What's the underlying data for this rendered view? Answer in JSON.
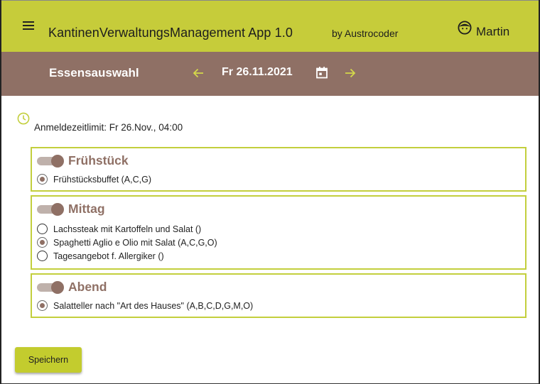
{
  "app": {
    "title": "KantinenVerwaltungsManagement App 1.0",
    "subtitle": "by Austrocoder",
    "user": "Martin"
  },
  "subbar": {
    "title": "Essensauswahl",
    "date": "Fr 26.11.2021"
  },
  "deadline": "Anmeldezeitlimit: Fr 26.Nov., 04:00",
  "sections": [
    {
      "title": "Frühstück",
      "enabled": true,
      "options": [
        {
          "label": "Frühstücksbuffet (A,C,G)",
          "selected": true
        }
      ]
    },
    {
      "title": "Mittag",
      "enabled": true,
      "options": [
        {
          "label": "Lachssteak mit Kartoffeln und Salat ()",
          "selected": false
        },
        {
          "label": "Spaghetti Aglio e Olio mit Salat (A,C,G,O)",
          "selected": true
        },
        {
          "label": "Tagesangebot f. Allergiker ()",
          "selected": false
        }
      ]
    },
    {
      "title": "Abend",
      "enabled": true,
      "options": [
        {
          "label": "Salatteller nach \"Art des Hauses\" (A,B,C,D,G,M,O)",
          "selected": true
        }
      ]
    }
  ],
  "save_label": "Speichern",
  "colors": {
    "appbar": "#c6cc3a",
    "subbar": "#8f7065",
    "accent": "#c3cf3d",
    "brown": "#8f7065"
  },
  "icons": [
    "menu-icon",
    "user-face-icon",
    "arrow-left-icon",
    "calendar-icon",
    "arrow-right-icon",
    "clock-icon"
  ]
}
